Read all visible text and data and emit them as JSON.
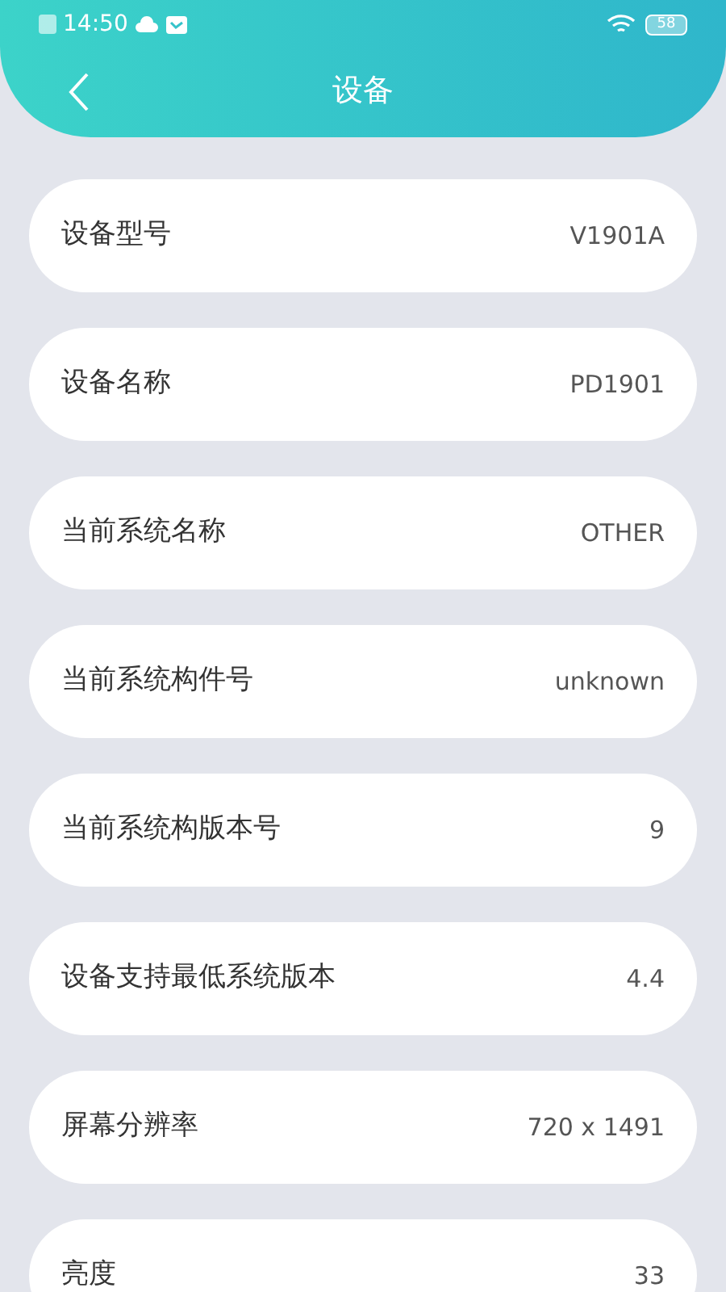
{
  "status_bar": {
    "time": "14:50",
    "battery": "58"
  },
  "header": {
    "title": "设备"
  },
  "rows": [
    {
      "label": "设备型号",
      "value": "V1901A"
    },
    {
      "label": "设备名称",
      "value": "PD1901"
    },
    {
      "label": "当前系统名称",
      "value": "OTHER"
    },
    {
      "label": "当前系统构件号",
      "value": "unknown"
    },
    {
      "label": "当前系统构版本号",
      "value": "9"
    },
    {
      "label": "设备支持最低系统版本",
      "value": "4.4"
    },
    {
      "label": "屏幕分辨率",
      "value": "720 x 1491"
    },
    {
      "label": "亮度",
      "value": "33"
    }
  ]
}
